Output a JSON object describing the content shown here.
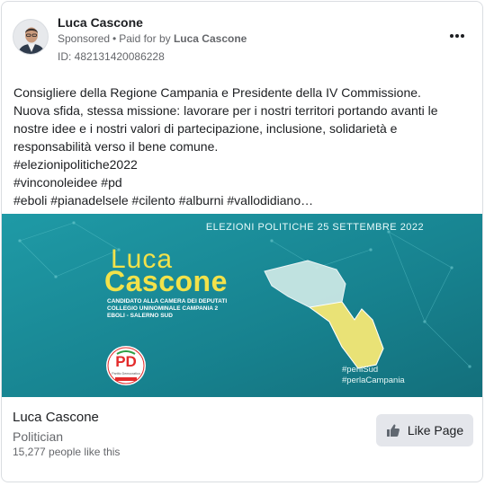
{
  "post": {
    "page_name": "Luca Cascone",
    "sponsored": "Sponsored",
    "separator": "•",
    "paid_for_prefix": "Paid for by",
    "paid_for_by": "Luca Cascone",
    "ad_id": "ID: 482131420086228",
    "body_lines": [
      "Consigliere della Regione Campania e Presidente della IV Commissione.",
      "Nuova sfida, stessa missione: lavorare per i nostri territori portando avanti le",
      "nostre idee e i nostri valori di partecipazione, inclusione, solidarietà e",
      "responsabilità verso il bene comune.",
      "#elezionipolitiche2022",
      "#vinconoleidee #pd",
      "#eboli #pianadelsele #cilento #alburni #vallodidiano…"
    ]
  },
  "creative": {
    "headline": "ELEZIONI POLITICHE 25 SETTEMBRE 2022",
    "first_name": "Luca",
    "last_name": "Cascone",
    "line1": "CANDIDATO ALLA CAMERA DEI DEPUTATI",
    "line2": "COLLEGIO UNINOMINALE CAMPANIA 2",
    "line3": "EBOLI - SALERNO SUD",
    "hashtag1": "#perilSud",
    "hashtag2": "#perlaCampania",
    "logo_text": "PD",
    "logo_sub": "Partito Democratico",
    "colors": {
      "bg": "#1a8d9a",
      "accent": "#f2e24a",
      "map_light": "#dff0ee",
      "map_yellow": "#ece477"
    }
  },
  "footer": {
    "page_name": "Luca Cascone",
    "category": "Politician",
    "likes": "15,277 people like this",
    "like_button": "Like Page"
  }
}
